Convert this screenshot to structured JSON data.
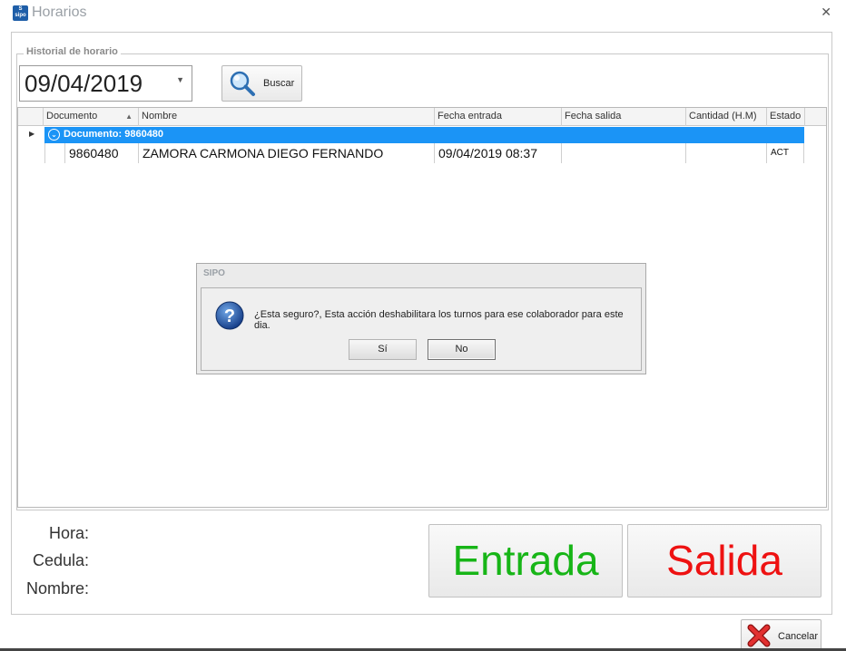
{
  "window": {
    "title": "Horarios",
    "app_icon_text": "sipo"
  },
  "historial": {
    "legend": "Historial de horario",
    "date_value": "09/04/2019",
    "buscar_label": "Buscar"
  },
  "grid": {
    "columns": [
      "Documento",
      "Nombre",
      "Fecha entrada",
      "Fecha salida",
      "Cantidad (H.M)",
      "Estado"
    ],
    "group_label": "Documento: 9860480",
    "row": {
      "documento": "9860480",
      "nombre": "ZAMORA CARMONA DIEGO FERNANDO",
      "fecha_entrada": "09/04/2019 08:37",
      "fecha_salida": "",
      "cantidad": "",
      "estado": "ACT"
    }
  },
  "dialog": {
    "title": "SIPO",
    "message": "¿Esta seguro?, Esta acción deshabilitara los turnos para ese colaborador para este dia.",
    "yes_label": "Sí",
    "no_label": "No"
  },
  "info": {
    "hora_label": "Hora:",
    "cedula_label": "Cedula:",
    "nombre_label": "Nombre:"
  },
  "actions": {
    "entrada_label": "Entrada",
    "salida_label": "Salida",
    "cancelar_label": "Cancelar",
    "entrada_color": "#17b517",
    "salida_color": "#ee1111"
  },
  "colors": {
    "group_row_bg": "#1b94f6",
    "accent": "#1e5ea8"
  },
  "icons": {
    "app": "sipo-logo-icon",
    "close": "close-icon",
    "search": "magnifier-icon",
    "question": "question-icon",
    "cancel": "red-x-icon",
    "row_indicator": "row-indicator-icon",
    "group_collapse": "collapse-icon",
    "sort": "sort-ascending-icon",
    "combo": "chevron-down-icon"
  }
}
